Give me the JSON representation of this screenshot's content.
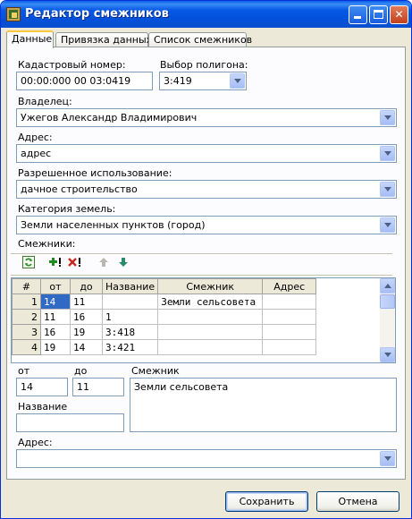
{
  "window": {
    "title": "Редактор смежников"
  },
  "tabs": [
    {
      "label": "Данные",
      "active": true
    },
    {
      "label": "Привязка данных",
      "active": false
    },
    {
      "label": "Список смежников",
      "active": false
    }
  ],
  "form": {
    "cadastral": {
      "label": "Кадастровый номер:",
      "value": "00:00:000 00 03:0419"
    },
    "polygon": {
      "label": "Выбор полигона:",
      "value": "3:419"
    },
    "owner": {
      "label": "Владелец:",
      "value": "Ужегов Александр Владимирович"
    },
    "address": {
      "label": "Адрес:",
      "value": "адрес"
    },
    "permitted_use": {
      "label": "Разрешенное использование:",
      "value": "дачное строительство"
    },
    "land_category": {
      "label": "Категория земель:",
      "value": "Земли населенных пунктов (город)"
    },
    "neighbors_label": "Смежники:"
  },
  "toolbar": {
    "icons": [
      "refresh-icon",
      "add-icon",
      "delete-icon",
      "move-up-icon",
      "move-down-icon"
    ]
  },
  "grid": {
    "columns": [
      "#",
      "от",
      "до",
      "Название",
      "Смежник",
      "Адрес"
    ],
    "rows": [
      {
        "n": "1",
        "from": "14",
        "to": "11",
        "name": "",
        "neighbor": "Земли сельсовета",
        "address": ""
      },
      {
        "n": "2",
        "from": "11",
        "to": "16",
        "name": "1",
        "neighbor": "",
        "address": ""
      },
      {
        "n": "3",
        "from": "16",
        "to": "19",
        "name": "3:418",
        "neighbor": "",
        "address": ""
      },
      {
        "n": "4",
        "from": "19",
        "to": "14",
        "name": "3:421",
        "neighbor": "",
        "address": ""
      }
    ]
  },
  "detail": {
    "from": {
      "label": "от",
      "value": "14"
    },
    "to": {
      "label": "до",
      "value": "11"
    },
    "neighbor": {
      "label": "Смежник",
      "value": "Земли сельсовета"
    },
    "name": {
      "label": "Название",
      "value": ""
    },
    "address": {
      "label": "Адрес:",
      "value": ""
    }
  },
  "buttons": {
    "save": "Сохранить",
    "cancel": "Отмена"
  }
}
